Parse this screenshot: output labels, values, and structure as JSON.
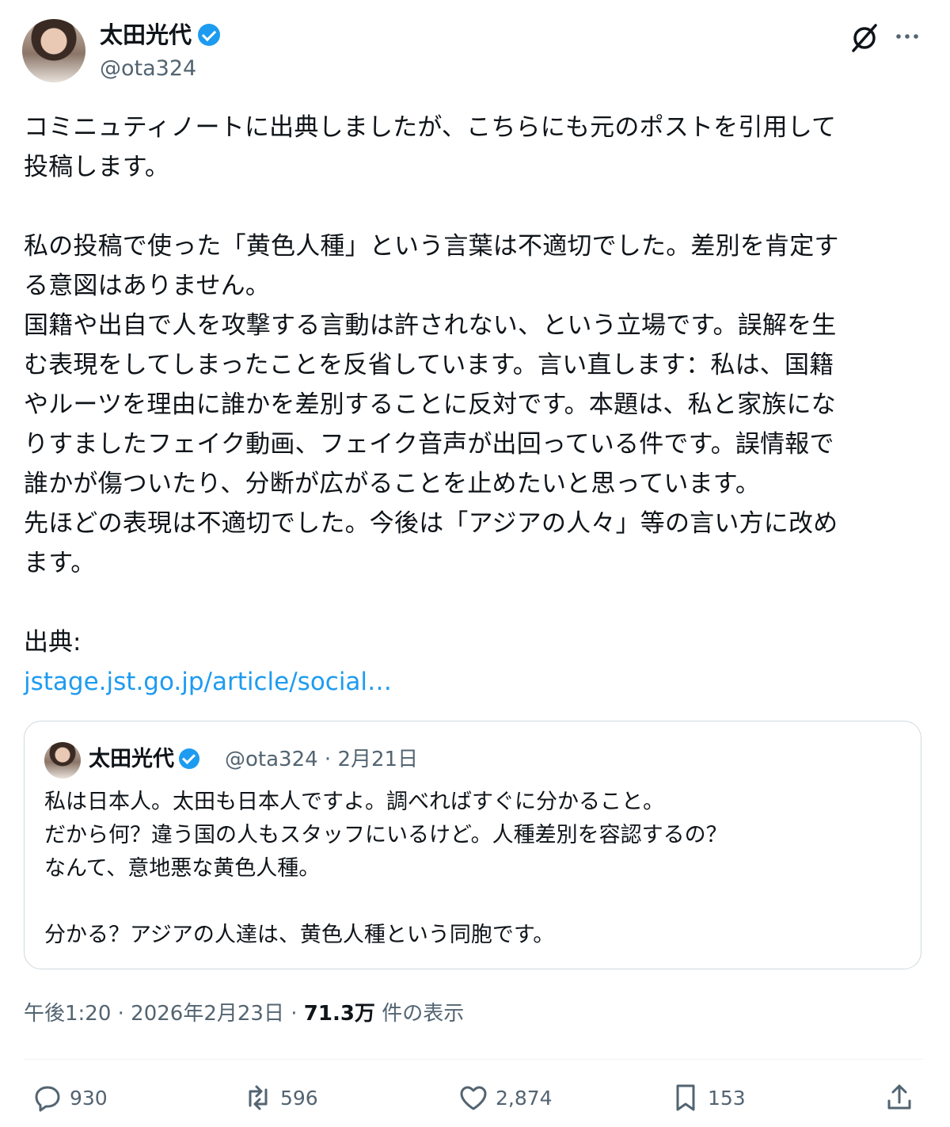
{
  "tweet": {
    "author_name": "太田光代",
    "handle": "@ota324",
    "body": "コミニュティノートに出典しましたが、こちらにも元のポストを引用して\n投稿します。\n\n私の投稿で使った「黄色人種」という言葉は不適切でした。差別を肯定す\nる意図はありません。\n国籍や出自で人を攻撃する言動は許されない、という立場です。誤解を生\nむ表現をしてしまったことを反省しています。言い直します：私は、国籍\nやルーツを理由に誰かを差別することに反対です。本題は、私と家族にな\nりすましたフェイク動画、フェイク音声が出回っている件です。誤情報で\n誰かが傷ついたり、分断が広がることを止めたいと思っています。\n先ほどの表現は不適切でした。今後は「アジアの人々」等の言い方に改め\nます。",
    "source_label": "出典:",
    "link": "jstage.jst.go.jp/article/social…",
    "time": "午後1:20 · 2026年2月23日 · ",
    "views_count": "71.3万",
    "views_label": " 件の表示"
  },
  "quote": {
    "author_name": "太田光代",
    "meta": "@ota324 · 2月21日",
    "body": "私は日本人。太田も日本人ですよ。調べればすぐに分かること。\nだから何？違う国の人もスタッフにいるけど。人種差別を容認するの？\nなんて、意地悪な黄色人種。\n\n分かる？アジアの人達は、黄色人種という同胞です。"
  },
  "actions": {
    "replies": "930",
    "reposts": "596",
    "likes": "2,874",
    "bookmarks": "153"
  },
  "colors": {
    "accent": "#1d9bf0",
    "secondary_text": "#536471",
    "border": "#cfd9de"
  }
}
